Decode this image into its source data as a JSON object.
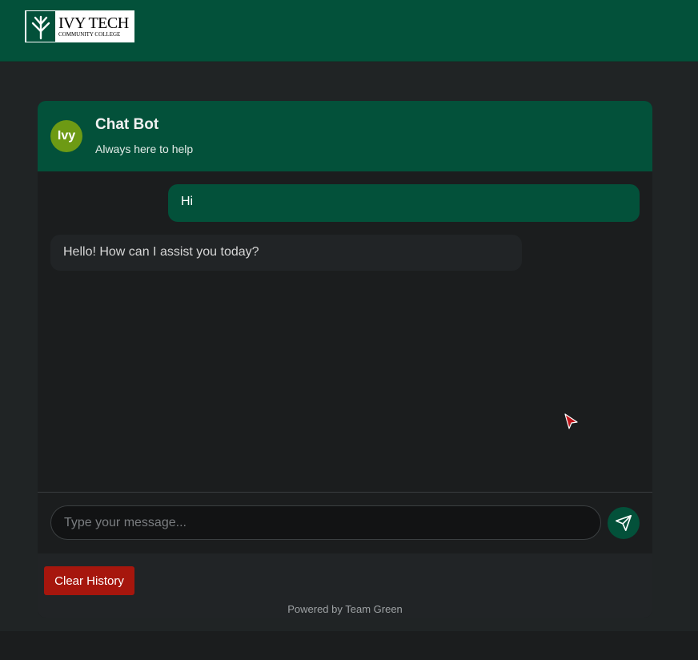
{
  "brand": {
    "logo_name": "IVY TECH",
    "logo_sub": "COMMUNITY COLLEGE",
    "bar_color": "#03513a"
  },
  "chat": {
    "avatar_text": "Ivy",
    "title": "Chat Bot",
    "tagline": "Always here to help",
    "messages": [
      {
        "sender": "user",
        "text": "Hi"
      },
      {
        "sender": "bot",
        "text": "Hello! How can I assist you today?"
      }
    ],
    "input": {
      "value": "",
      "placeholder": "Type your message..."
    },
    "send_icon": "send-icon",
    "clear_label": "Clear History",
    "powered_by": "Powered by Team Green"
  },
  "colors": {
    "accent_green": "#03513a",
    "avatar_green": "#6d9a14",
    "danger_red": "#a6160d",
    "cursor_red": "#c0161b"
  }
}
